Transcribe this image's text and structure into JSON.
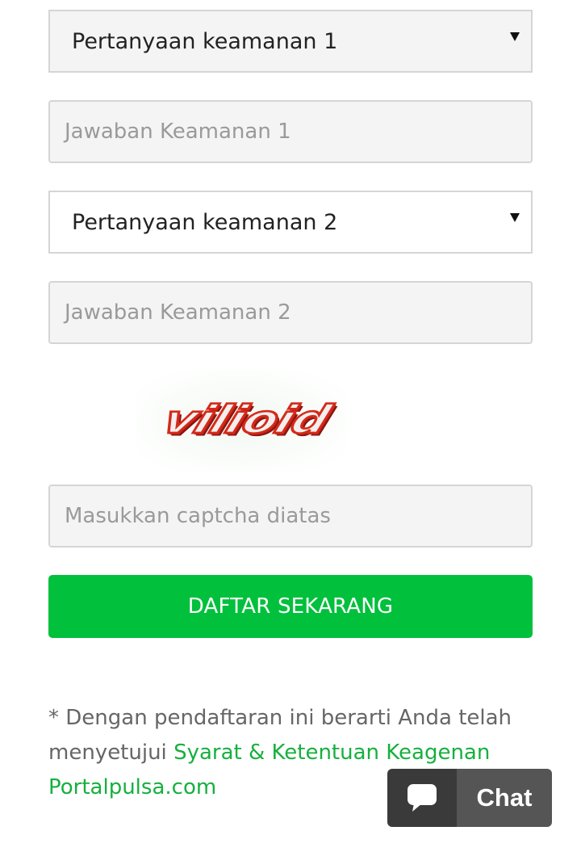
{
  "form": {
    "security_question_1": {
      "selected": "Pertanyaan keamanan 1"
    },
    "security_answer_1": {
      "placeholder": "Jawaban Keamanan 1"
    },
    "security_question_2": {
      "selected": "Pertanyaan keamanan 2"
    },
    "security_answer_2": {
      "placeholder": "Jawaban Keamanan 2"
    },
    "captcha": {
      "text": "vilioid",
      "color": "#d42a1a"
    },
    "captcha_input": {
      "placeholder": "Masukkan captcha diatas"
    },
    "submit": {
      "label": "DAFTAR SEKARANG",
      "color": "#00c03c"
    }
  },
  "terms": {
    "prefix": "* Dengan pendaftaran ini berarti Anda telah menyetujui ",
    "link_text": "Syarat & Ketentuan Keagenan Portalpulsa.com",
    "link_color": "#16b03e"
  },
  "chat_widget": {
    "icon": "chat-bubble-icon",
    "label": "Chat"
  }
}
